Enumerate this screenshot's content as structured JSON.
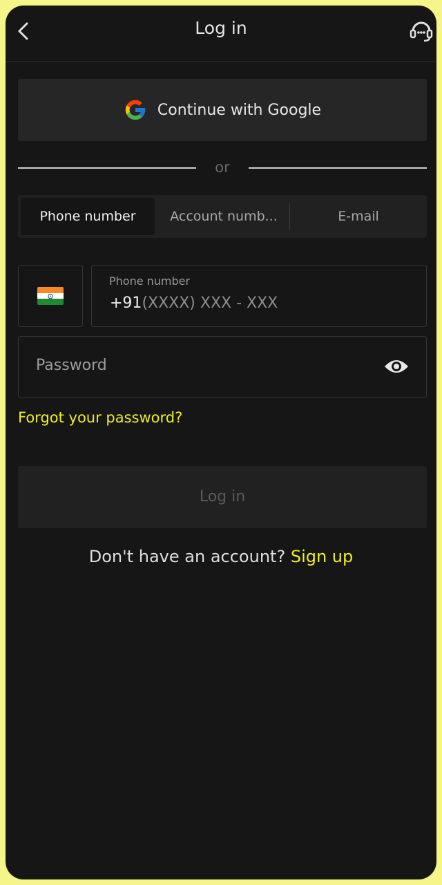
{
  "header": {
    "title": "Log in",
    "back_icon": "chevron-left-icon",
    "support_icon": "headset-support-icon"
  },
  "google": {
    "label": "Continue with Google",
    "icon": "google-g-icon"
  },
  "divider": {
    "text": "or"
  },
  "tabs": [
    {
      "label": "Phone number",
      "active": true
    },
    {
      "label": "Account numb...",
      "active": false
    },
    {
      "label": "E-mail",
      "active": false
    }
  ],
  "country": {
    "flag": "india-flag-icon"
  },
  "phone_field": {
    "label": "Phone number",
    "prefix": "+91",
    "placeholder_mask": "(XXXX) XXX - XXX"
  },
  "password_field": {
    "placeholder": "Password",
    "toggle_icon": "eye-icon"
  },
  "forgot_link": "Forgot your password?",
  "login_button": "Log in",
  "signup": {
    "question": "Don't have an account?",
    "link": "Sign up"
  },
  "colors": {
    "background": "#161616",
    "accent": "#eeee1e",
    "frame": "#f6f58a",
    "surface": "#262626"
  }
}
